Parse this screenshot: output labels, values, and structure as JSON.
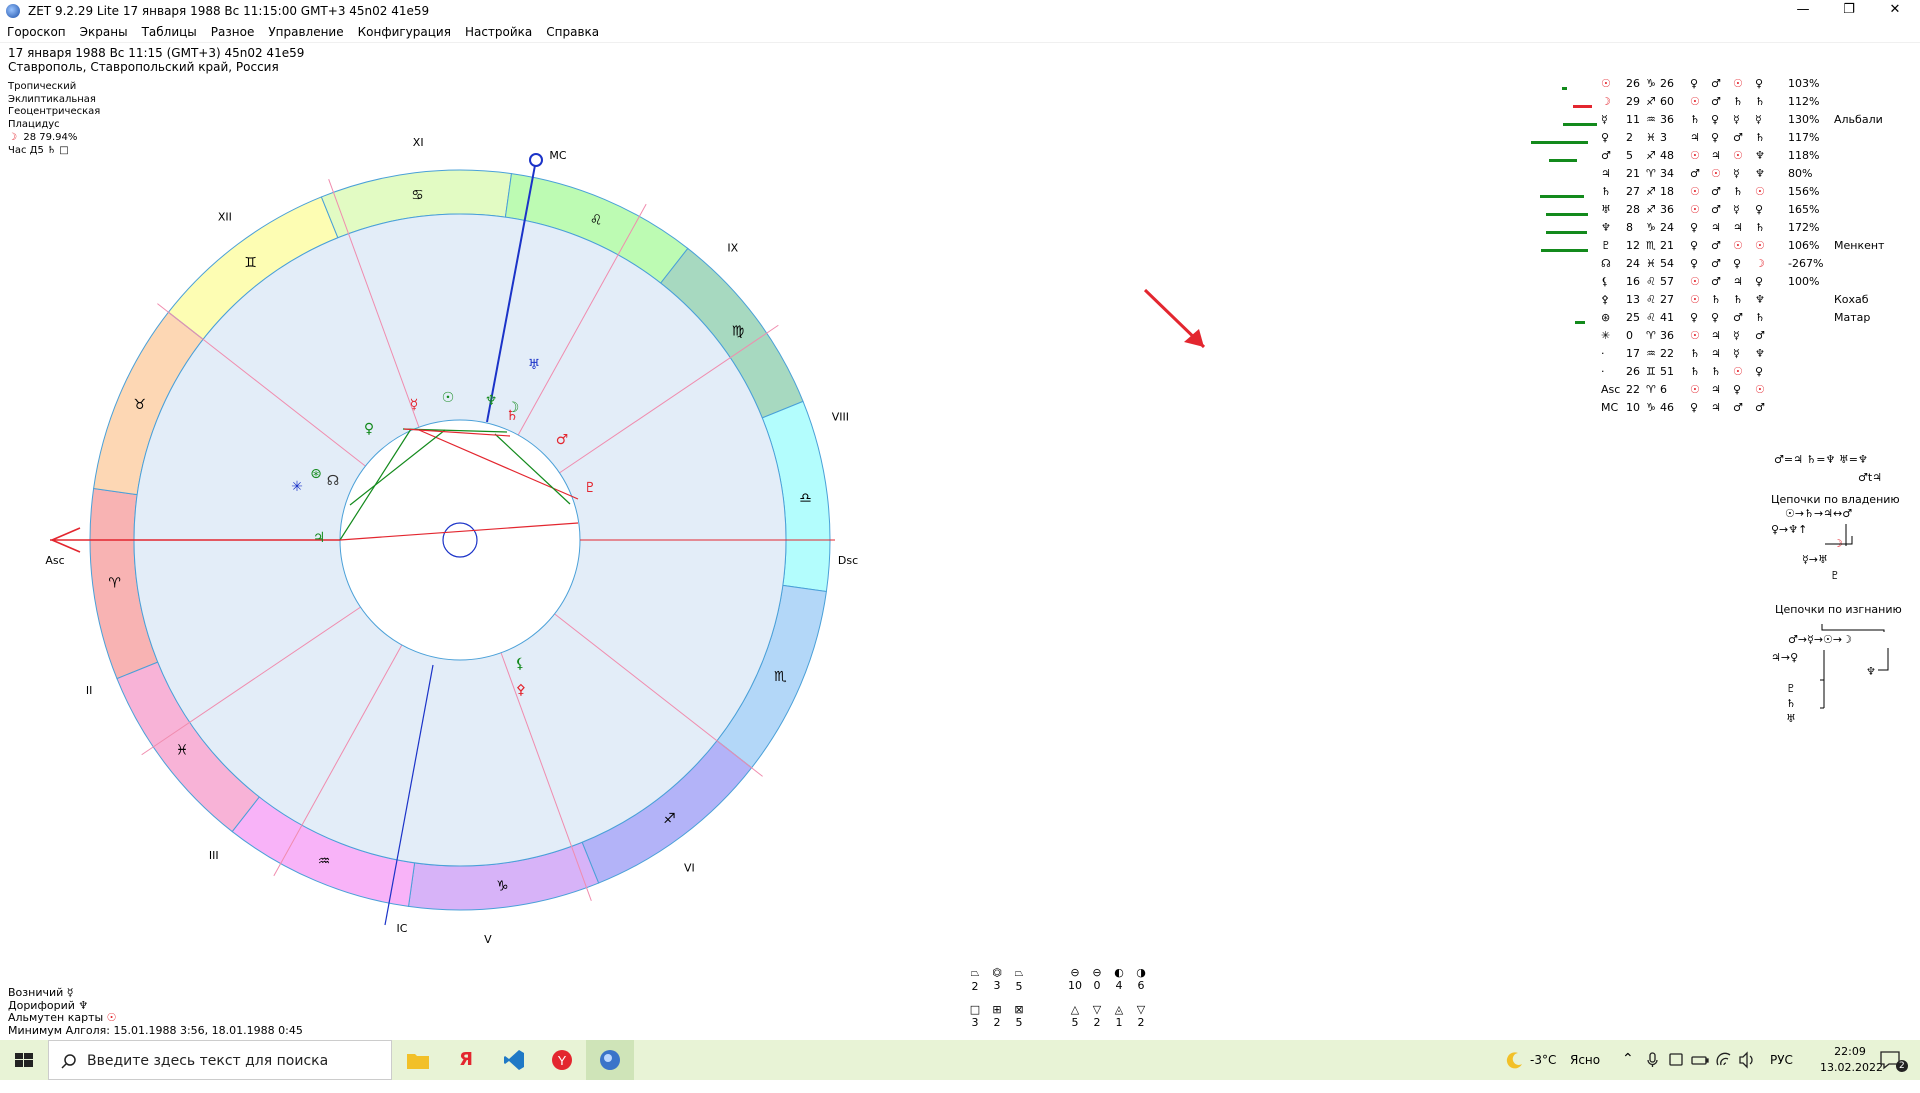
{
  "window": {
    "title": "ZET 9.2.29 Lite   17 января 1988  Вс  11:15:00 GMT+3 45n02  41e59",
    "minimize": "—",
    "restore": "❐",
    "close": "✕"
  },
  "menu": [
    "Гороскоп",
    "Экраны",
    "Таблицы",
    "Разное",
    "Управление",
    "Конфигурация",
    "Настройка",
    "Справка"
  ],
  "header": {
    "line1": "17 января 1988  Вс  11:15 (GMT+3) 45n02  41e59",
    "line2": "Ставрополь, Ставропольский край, Россия"
  },
  "meta": {
    "zodiac": "Тропический",
    "coords": "Эклиптикальная",
    "center": "Геоцентрическая",
    "houses": "Плацидус",
    "moon_symbol": "☽",
    "moon_text": "28 79.94%",
    "hour_text": "Час Д5",
    "hour_symbol": "♄",
    "hour_box": "□"
  },
  "chart": {
    "houses": [
      "I",
      "II",
      "III",
      "IV",
      "V",
      "VI",
      "VII",
      "VIII",
      "IX",
      "X",
      "XI",
      "XII"
    ],
    "house_labels": {
      "I": "Asc",
      "IV": "IC",
      "VII": "Dsc",
      "X": "MC"
    },
    "signs": [
      "♈",
      "♉",
      "♊",
      "♋",
      "♌",
      "♍",
      "♎",
      "♏",
      "♐",
      "♑",
      "♒",
      "♓"
    ],
    "sign_colors": [
      "#f8b3b3",
      "#fdd7b4",
      "#fdfdb3",
      "#e2fbc3",
      "#bdfbb3",
      "#a7d9c0",
      "#b3fdfd",
      "#b3d7f8",
      "#b3b3f8",
      "#d7b3f8",
      "#f8b3f8",
      "#f8b3d7"
    ],
    "planets": [
      {
        "glyph": "☉",
        "color": "#138a1c"
      },
      {
        "glyph": "☽",
        "color": "#138a1c"
      },
      {
        "glyph": "☿",
        "color": "#e3262f"
      },
      {
        "glyph": "♀",
        "color": "#138a1c"
      },
      {
        "glyph": "♂",
        "color": "#e3262f"
      },
      {
        "glyph": "♃",
        "color": "#138a1c"
      },
      {
        "glyph": "♄",
        "color": "#e3262f"
      },
      {
        "glyph": "♅",
        "color": "#1b33c8"
      },
      {
        "glyph": "♆",
        "color": "#138a1c"
      },
      {
        "glyph": "♇",
        "color": "#e3262f"
      },
      {
        "glyph": "☊",
        "color": "#333333"
      },
      {
        "glyph": "⊛",
        "color": "#138a1c"
      },
      {
        "glyph": "✳",
        "color": "#1b33c8"
      },
      {
        "glyph": "⚸",
        "color": "#138a1c"
      },
      {
        "glyph": "⚴",
        "color": "#e3262f"
      }
    ]
  },
  "table": [
    {
      "g": "☉",
      "d": "26",
      "s": "♑",
      "m": "26",
      "a": "♀",
      "b": "♂",
      "c": "☉",
      "e": "♀",
      "p": "103%",
      "n": ""
    },
    {
      "g": "☽",
      "d": "29",
      "s": "♐",
      "m": "60",
      "a": "☉",
      "b": "♂",
      "c": "♄",
      "e": "♄",
      "p": "112%",
      "n": ""
    },
    {
      "g": "☿",
      "d": "11",
      "s": "♒",
      "m": "36",
      "a": "♄",
      "b": "♀",
      "c": "☿",
      "e": "☿",
      "p": "130%",
      "n": "Альбали"
    },
    {
      "g": "♀",
      "d": "2",
      "s": "♓",
      "m": "3",
      "a": "♃",
      "b": "♀",
      "c": "♂",
      "e": "♄",
      "p": "117%",
      "n": ""
    },
    {
      "g": "♂",
      "d": "5",
      "s": "♐",
      "m": "48",
      "a": "☉",
      "b": "♃",
      "c": "☉",
      "e": "♆",
      "p": "118%",
      "n": ""
    },
    {
      "g": "♃",
      "d": "21",
      "s": "♈",
      "m": "34",
      "a": "♂",
      "b": "☉",
      "c": "☿",
      "e": "♆",
      "p": "80%",
      "n": ""
    },
    {
      "g": "♄",
      "d": "27",
      "s": "♐",
      "m": "18",
      "a": "☉",
      "b": "♂",
      "c": "♄",
      "e": "☉",
      "p": "156%",
      "n": ""
    },
    {
      "g": "♅",
      "d": "28",
      "s": "♐",
      "m": "36",
      "a": "☉",
      "b": "♂",
      "c": "☿",
      "e": "♀",
      "p": "165%",
      "n": ""
    },
    {
      "g": "♆",
      "d": "8",
      "s": "♑",
      "m": "24",
      "a": "♀",
      "b": "♃",
      "c": "♃",
      "e": "♄",
      "p": "172%",
      "n": ""
    },
    {
      "g": "♇",
      "d": "12",
      "s": "♏",
      "m": "21",
      "a": "♀",
      "b": "♂",
      "c": "☉",
      "e": "☉",
      "p": "106%",
      "n": "Менкент"
    },
    {
      "g": "☊",
      "d": "24",
      "s": "♓",
      "m": "54",
      "a": "♀",
      "b": "♂",
      "c": "♀",
      "e": "☽",
      "p": "-267%",
      "n": ""
    },
    {
      "g": "⚸",
      "d": "16",
      "s": "♌",
      "m": "57",
      "a": "☉",
      "b": "♂",
      "c": "♃",
      "e": "♀",
      "p": "100%",
      "n": ""
    },
    {
      "g": "⚴",
      "d": "13",
      "s": "♌",
      "m": "27",
      "a": "☉",
      "b": "♄",
      "c": "♄",
      "e": "♆",
      "p": "",
      "n": "Кохаб"
    },
    {
      "g": "⊛",
      "d": "25",
      "s": "♌",
      "m": "41",
      "a": "♀",
      "b": "♀",
      "c": "♂",
      "e": "♄",
      "p": "",
      "n": "Матар"
    },
    {
      "g": "✳",
      "d": "0",
      "s": "♈",
      "m": "36",
      "a": "☉",
      "b": "♃",
      "c": "☿",
      "e": "♂",
      "p": "",
      "n": ""
    },
    {
      "g": "·",
      "d": "17",
      "s": "♒",
      "m": "22",
      "a": "♄",
      "b": "♃",
      "c": "☿",
      "e": "♆",
      "p": "",
      "n": ""
    },
    {
      "g": "·",
      "d": "26",
      "s": "♊",
      "m": "51",
      "a": "♄",
      "b": "♄",
      "c": "☉",
      "e": "♀",
      "p": "",
      "n": ""
    },
    {
      "g": "Asc",
      "d": "22",
      "s": "♈",
      "m": "6",
      "a": "☉",
      "b": "♃",
      "c": "♀",
      "e": "☉",
      "p": "",
      "n": ""
    },
    {
      "g": "MC",
      "d": "10",
      "s": "♑",
      "m": "46",
      "a": "♀",
      "b": "♃",
      "c": "♂",
      "e": "♂",
      "p": "",
      "n": ""
    }
  ],
  "right_panel": {
    "formula1": "♂=♃ ♄=♆ ♅=♆",
    "formula2": "♂t♃",
    "chain_own_title": "Цепочки по владению",
    "chain_own_1": "☉→♄→♃↔♂",
    "chain_own_2": "♀→♆↑",
    "chain_own_3": "☽",
    "chain_own_4": "☿→♅",
    "chain_own_5": "♇",
    "chain_exile_title": "Цепочки по изгнанию",
    "chain_exile_1": "♂→☿→☉→☽",
    "chain_exile_2": "♃→♀",
    "chain_exile_3": "♆",
    "chain_exile_4": "♇",
    "chain_exile_5": "♄",
    "chain_exile_6": "♅"
  },
  "bottom_info": {
    "l1_label": "Возничий",
    "l1_sym": "☿",
    "l2_label": "Дорифорий",
    "l2_sym": "♆",
    "l3_label": "Альмутен карты",
    "l3_sym": "☉",
    "l4": "Минимум Алголя: 15.01.1988  3:56,  18.01.1988  0:45"
  },
  "bottom_icons": [
    {
      "glyph": "⏢",
      "value": "2"
    },
    {
      "glyph": "⏣",
      "value": "3"
    },
    {
      "glyph": "⏢",
      "value": "5"
    },
    {
      "glyph": "⊖",
      "value": "10"
    },
    {
      "glyph": "⊖",
      "value": "0"
    },
    {
      "glyph": "◐",
      "value": "4"
    },
    {
      "glyph": "◑",
      "value": "6"
    },
    {
      "glyph": "□",
      "value": "3"
    },
    {
      "glyph": "⊞",
      "value": "2"
    },
    {
      "glyph": "⊠",
      "value": "5"
    },
    {
      "glyph": "△",
      "value": "5"
    },
    {
      "glyph": "▽",
      "value": "2"
    },
    {
      "glyph": "◬",
      "value": "1"
    },
    {
      "glyph": "▽",
      "value": "2"
    }
  ],
  "taskbar": {
    "search_placeholder": "Введите здесь текст для поиска",
    "weather_temp": "-3°C",
    "weather_text": "Ясно",
    "lang": "РУС",
    "time": "22:09",
    "date": "13.02.2022",
    "notif_count": "2"
  }
}
